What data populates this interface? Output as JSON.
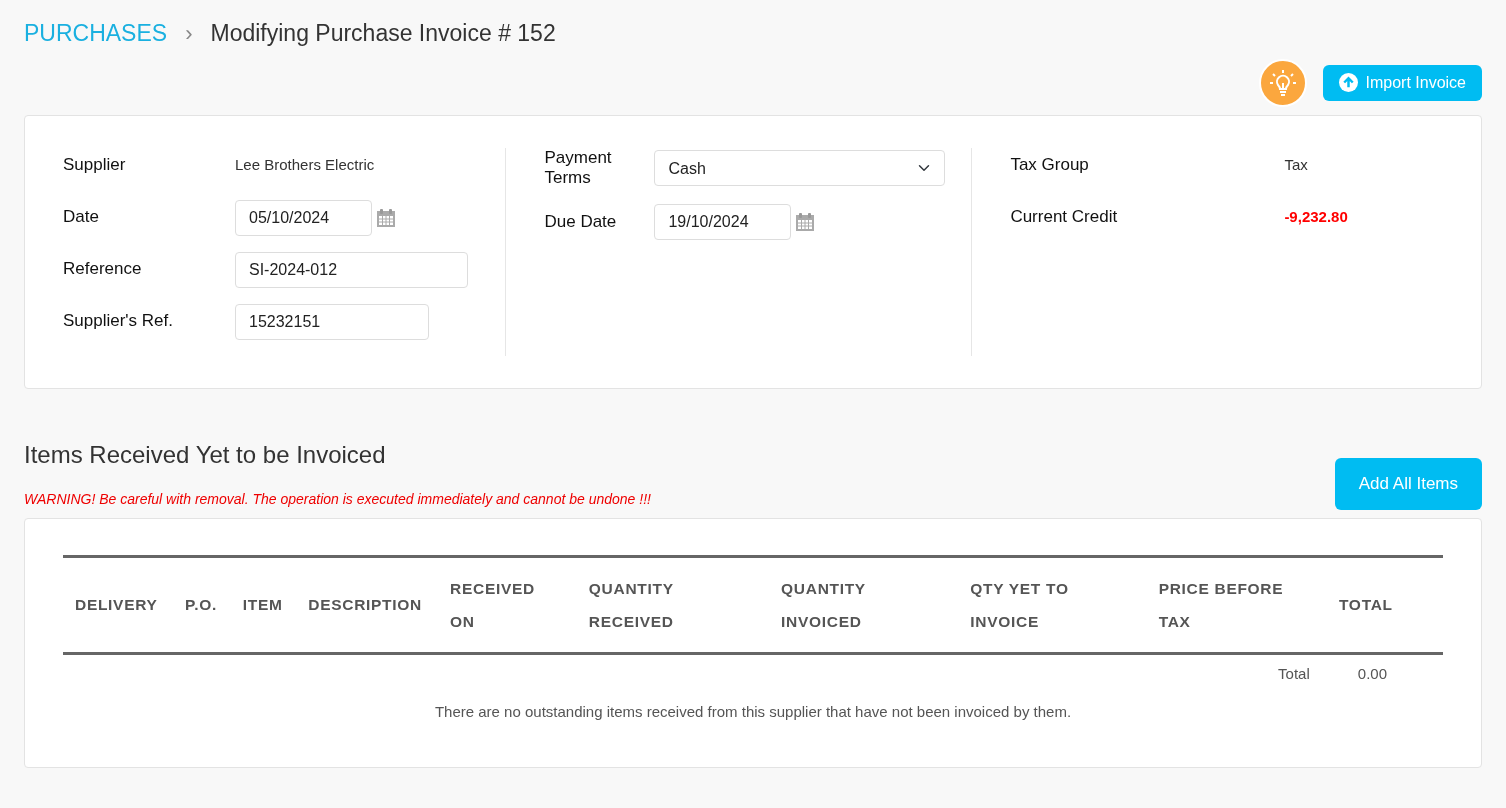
{
  "breadcrumb": {
    "section": "PURCHASES",
    "separator": "›",
    "title": "Modifying Purchase Invoice # 152"
  },
  "actions": {
    "import_button": "Import Invoice"
  },
  "header": {
    "column_1": [
      {
        "label": "Supplier",
        "kind": "text",
        "value": "Lee Brothers Electric"
      },
      {
        "label": "Date",
        "kind": "date",
        "value": "05/10/2024"
      },
      {
        "label": "Reference",
        "kind": "input",
        "value": "SI-2024-012"
      },
      {
        "label": "Supplier's Ref.",
        "kind": "input",
        "value": "15232151"
      }
    ],
    "column_2": [
      {
        "label": "Payment Terms",
        "kind": "select",
        "value": "Cash"
      },
      {
        "label": "Due Date",
        "kind": "date",
        "value": "19/10/2024"
      }
    ],
    "column_3": [
      {
        "label": "Tax Group",
        "kind": "text",
        "value": "Tax"
      },
      {
        "label": "Current Credit",
        "kind": "negative",
        "value": "-9,232.80"
      }
    ]
  },
  "items_section": {
    "title": "Items Received Yet to be Invoiced",
    "warning": "WARNING! Be careful with removal. The operation is executed immediately and cannot be undone !!!",
    "add_button": "Add All Items",
    "table": {
      "columns": [
        [
          "DELIVERY"
        ],
        [
          "P.O."
        ],
        [
          "ITEM"
        ],
        [
          "DESCRIPTION"
        ],
        [
          "RECEIVED",
          "ON"
        ],
        [
          "QUANTITY",
          "RECEIVED"
        ],
        [
          "QUANTITY",
          "INVOICED"
        ],
        [
          "QTY YET TO",
          "INVOICE"
        ],
        [
          "PRICE BEFORE",
          "TAX"
        ],
        [
          "TOTAL"
        ]
      ],
      "total_label": "Total",
      "total_value": "0.00",
      "empty_message": "There are no outstanding items received from this supplier that have not been invoiced by them."
    }
  }
}
